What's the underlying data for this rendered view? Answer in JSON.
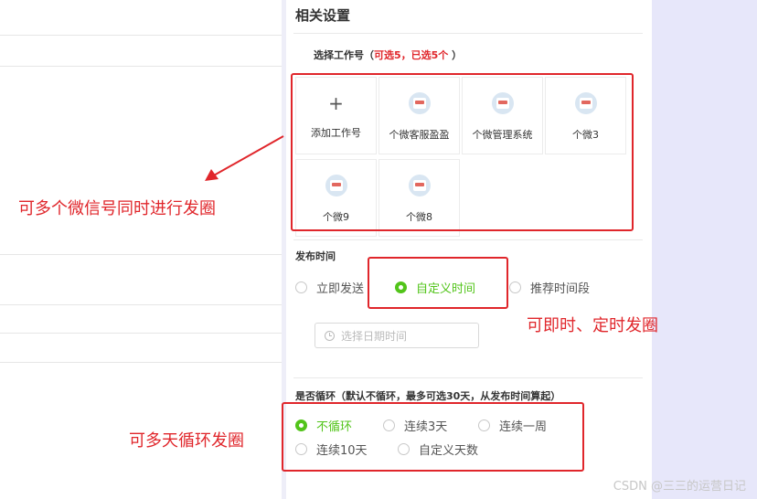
{
  "panel": {
    "title": "相关设置"
  },
  "select_accounts": {
    "label_prefix": "选择工作号（",
    "label_highlight": "可选5，已选5个",
    "label_suffix": " ）",
    "add_label": "添加工作号",
    "add_icon": "plus-icon",
    "accounts": [
      {
        "name": "个微客服盈盈"
      },
      {
        "name": "个微管理系统"
      },
      {
        "name": "个微3"
      },
      {
        "name": "个微9"
      },
      {
        "name": "个微8"
      }
    ]
  },
  "publish_time": {
    "label": "发布时间",
    "options": [
      {
        "label": "立即发送",
        "selected": false
      },
      {
        "label": "自定义时间",
        "selected": true
      },
      {
        "label": "推荐时间段",
        "selected": false
      }
    ],
    "date_placeholder": "选择日期时间"
  },
  "loop": {
    "label": "是否循环（默认不循环，最多可选30天，从发布时间算起）",
    "options": [
      {
        "label": "不循环",
        "selected": true
      },
      {
        "label": "连续3天",
        "selected": false
      },
      {
        "label": "连续一周",
        "selected": false
      },
      {
        "label": "连续10天",
        "selected": false
      },
      {
        "label": "自定义天数",
        "selected": false
      }
    ]
  },
  "annotations": {
    "multi_account": "可多个微信号同时进行发圈",
    "timing": "可即时、定时发圈",
    "loop": "可多天循环发圈"
  },
  "watermark": "CSDN @三三的运营日记",
  "colors": {
    "accent_green": "#52c41a",
    "annotation_red": "#e0262b",
    "strip": "#e7e7fa"
  }
}
